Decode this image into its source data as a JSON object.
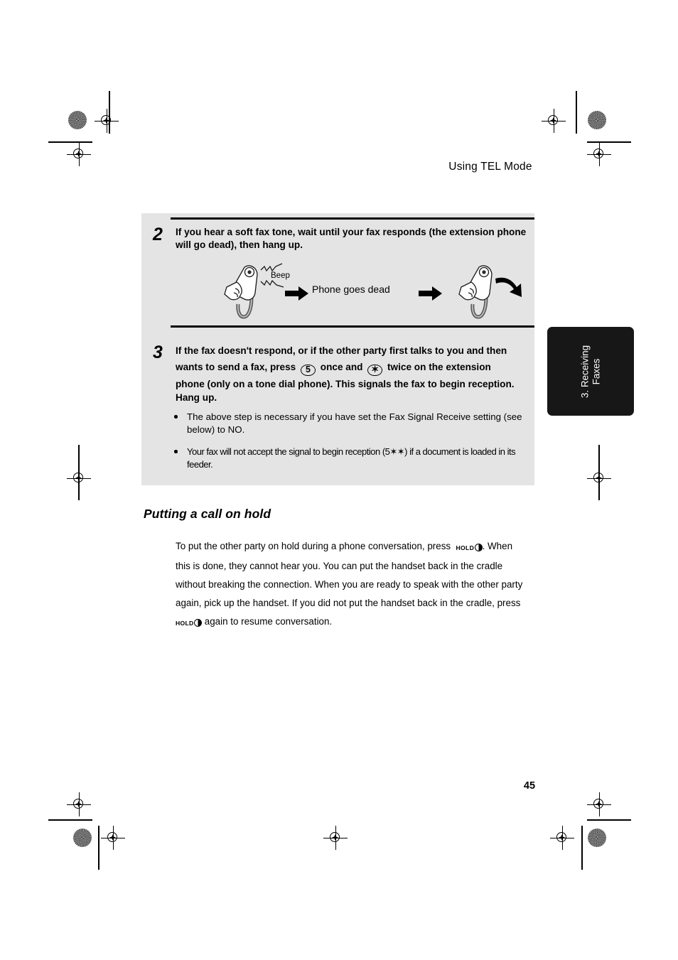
{
  "page": {
    "header_title": "Using TEL Mode",
    "page_number": "45",
    "side_tab_line1": "3. Receiving",
    "side_tab_line2": "Faxes",
    "box_background_color": "#e4e4e4",
    "tab_background_color": "#171717"
  },
  "steps": [
    {
      "number": "2",
      "text": "If you hear a soft fax tone, wait until your fax responds (the extension phone will go dead), then hang up."
    },
    {
      "number": "3",
      "text_part1": "If the fax doesn't respond, or if the other party first talks to you and then",
      "text_part2_a": "wants to send a fax, press",
      "key1_label": "5",
      "text_part2_b": "once and",
      "key2_label": "✶",
      "text_part2_c": "twice on the extension",
      "text_part3": "phone (only on a tone dial phone). This signals the fax to begin reception. Hang up."
    }
  ],
  "figure": {
    "beep_label": "Beep",
    "caption": "Phone goes dead",
    "handset_left_icon": "handset-ringing-icon",
    "handset_right_icon": "handset-hangup-icon",
    "arrow_icon": "right-arrow-icon"
  },
  "bullets": [
    "The above step is necessary if you have set the Fax Signal Receive setting (see below) to NO.",
    "Your fax will not accept the signal to begin reception (5✶✶) if a document is loaded in its feeder."
  ],
  "hold_section": {
    "title": "Putting a call on hold",
    "text_a": "To put the other party on hold during a phone conversation, press",
    "hold_key_label": "HOLD",
    "text_b": ". When this is done, they cannot hear you. You can put the handset back in the cradle without breaking the connection. When you are ready to speak with the other party again, pick up the handset. If you did not put the handset back in the cradle, press",
    "text_c": "again to resume conversation."
  }
}
